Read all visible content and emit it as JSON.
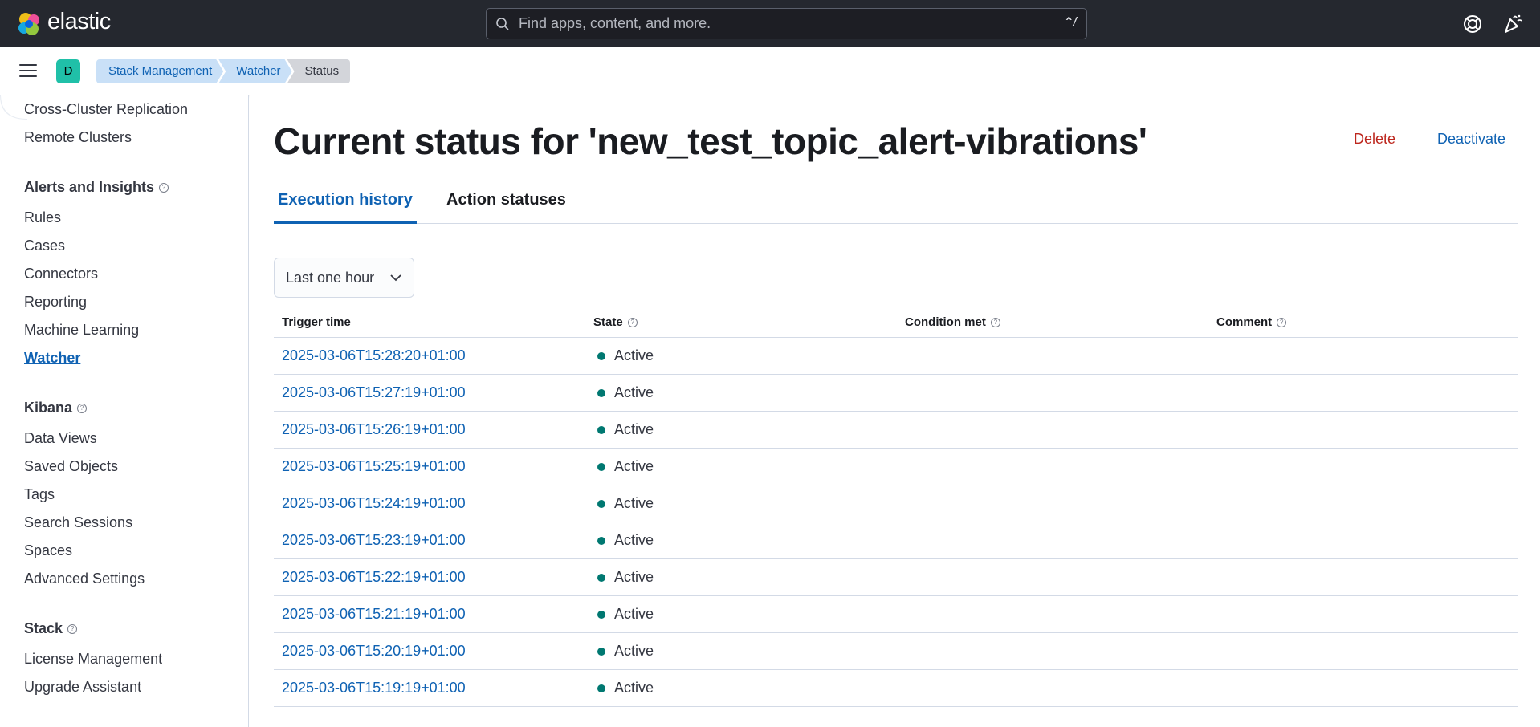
{
  "header": {
    "logo_text": "elastic",
    "search_placeholder": "Find apps, content, and more.",
    "search_shortcut": "^/",
    "icons": [
      "help-icon",
      "news-feed-icon"
    ]
  },
  "space": {
    "initial": "D"
  },
  "breadcrumbs": [
    "Stack Management",
    "Watcher",
    "Status"
  ],
  "sidebar": {
    "top_items": [
      "Cross-Cluster Replication",
      "Remote Clusters"
    ],
    "sections": [
      {
        "title": "Alerts and Insights",
        "items": [
          "Rules",
          "Cases",
          "Connectors",
          "Reporting",
          "Machine Learning",
          "Watcher"
        ]
      },
      {
        "title": "Kibana",
        "items": [
          "Data Views",
          "Saved Objects",
          "Tags",
          "Search Sessions",
          "Spaces",
          "Advanced Settings"
        ]
      },
      {
        "title": "Stack",
        "items": [
          "License Management",
          "Upgrade Assistant"
        ]
      }
    ],
    "active_item": "Watcher"
  },
  "main": {
    "title": "Current status for 'new_test_topic_alert-vibrations'",
    "delete_label": "Delete",
    "deactivate_label": "Deactivate",
    "tabs": [
      {
        "label": "Execution history",
        "active": true
      },
      {
        "label": "Action statuses",
        "active": false
      }
    ],
    "time_range": "Last one hour",
    "table": {
      "columns": [
        "Trigger time",
        "State",
        "Condition met",
        "Comment"
      ],
      "rows": [
        {
          "trigger_time": "2025-03-06T15:28:20+01:00",
          "state": "Active",
          "condition_met": "",
          "comment": ""
        },
        {
          "trigger_time": "2025-03-06T15:27:19+01:00",
          "state": "Active",
          "condition_met": "",
          "comment": ""
        },
        {
          "trigger_time": "2025-03-06T15:26:19+01:00",
          "state": "Active",
          "condition_met": "",
          "comment": ""
        },
        {
          "trigger_time": "2025-03-06T15:25:19+01:00",
          "state": "Active",
          "condition_met": "",
          "comment": ""
        },
        {
          "trigger_time": "2025-03-06T15:24:19+01:00",
          "state": "Active",
          "condition_met": "",
          "comment": ""
        },
        {
          "trigger_time": "2025-03-06T15:23:19+01:00",
          "state": "Active",
          "condition_met": "",
          "comment": ""
        },
        {
          "trigger_time": "2025-03-06T15:22:19+01:00",
          "state": "Active",
          "condition_met": "",
          "comment": ""
        },
        {
          "trigger_time": "2025-03-06T15:21:19+01:00",
          "state": "Active",
          "condition_met": "",
          "comment": ""
        },
        {
          "trigger_time": "2025-03-06T15:20:19+01:00",
          "state": "Active",
          "condition_met": "",
          "comment": ""
        },
        {
          "trigger_time": "2025-03-06T15:19:19+01:00",
          "state": "Active",
          "condition_met": "",
          "comment": ""
        }
      ]
    }
  },
  "colors": {
    "header_bg": "#25282f",
    "link": "#0f62b3",
    "danger": "#bd271e",
    "status_active": "#007871"
  }
}
